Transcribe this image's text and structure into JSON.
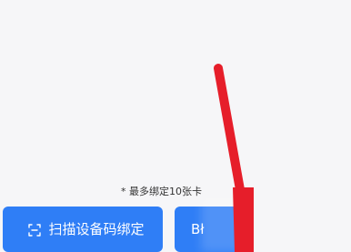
{
  "limit_note": "* 最多绑定10张卡",
  "buttons": {
    "scan": {
      "label": "扫描设备码绑定",
      "icon": "scan-code-icon",
      "color": "#2f7ef6"
    },
    "second": {
      "label": "Bł",
      "color": "#2f7ef6"
    }
  },
  "annotation": {
    "arrow_color": "#e61e2a"
  }
}
